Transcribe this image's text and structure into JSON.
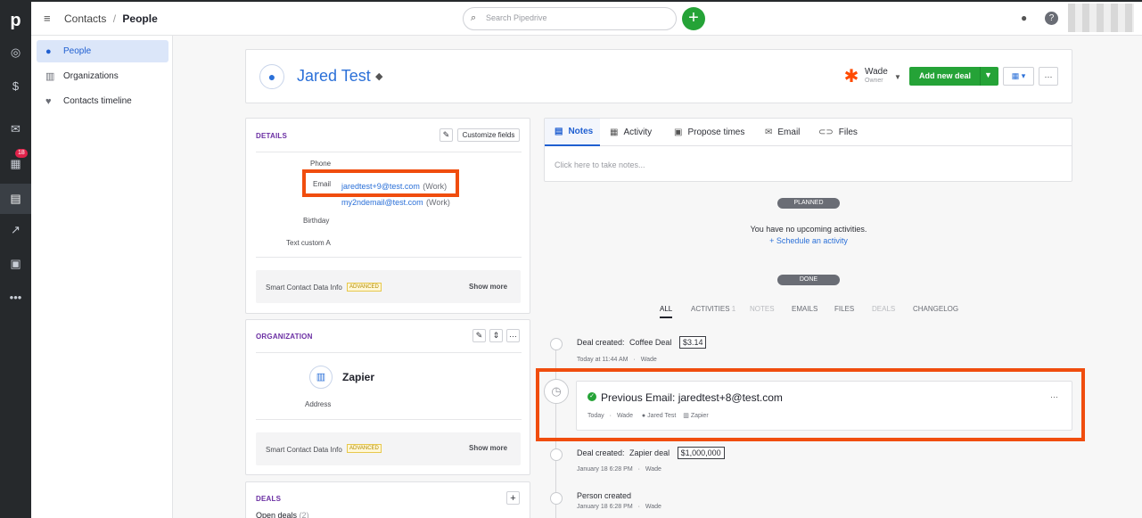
{
  "breadcrumb": {
    "section": "Contacts",
    "separator": "/",
    "page": "People"
  },
  "search": {
    "placeholder": "Search Pipedrive"
  },
  "leftbar": {
    "calendar_badge": "18"
  },
  "sidenav": {
    "items": [
      {
        "label": "People",
        "icon": "person-icon",
        "active": true
      },
      {
        "label": "Organizations",
        "icon": "building-icon",
        "active": false
      },
      {
        "label": "Contacts timeline",
        "icon": "heartbeat-icon",
        "active": false
      }
    ]
  },
  "person": {
    "name": "Jared Test",
    "owner_name": "Wade",
    "owner_label": "Owner",
    "add_deal_label": "Add new deal"
  },
  "details": {
    "title": "DETAILS",
    "customize_label": "Customize fields",
    "phone_label": "Phone",
    "email_label": "Email",
    "email1": "jaredtest+9@test.com",
    "email1_type": "(Work)",
    "email2": "my2ndemail@test.com",
    "email2_type": "(Work)",
    "birthday_label": "Birthday",
    "text_custom_label": "Text custom A",
    "smart_label": "Smart Contact Data Info",
    "advanced_badge": "ADVANCED",
    "show_more": "Show more"
  },
  "organization": {
    "title": "ORGANIZATION",
    "name": "Zapier",
    "address_label": "Address",
    "smart_label": "Smart Contact Data Info",
    "advanced_badge": "ADVANCED",
    "show_more": "Show more"
  },
  "deals": {
    "title": "DEALS",
    "open_label": "Open deals",
    "open_count": "(2)"
  },
  "tabs": [
    {
      "label": "Notes",
      "active": true
    },
    {
      "label": "Activity",
      "active": false
    },
    {
      "label": "Propose times",
      "active": false
    },
    {
      "label": "Email",
      "active": false
    },
    {
      "label": "Files",
      "active": false
    }
  ],
  "notes": {
    "placeholder": "Click here to take notes..."
  },
  "planned": {
    "pill": "PLANNED",
    "empty_text": "You have no upcoming activities.",
    "schedule_link": "+ Schedule an activity"
  },
  "done": {
    "pill": "DONE"
  },
  "filter_tabs": [
    {
      "label": "ALL",
      "state": "active"
    },
    {
      "label": "ACTIVITIES",
      "count": "1",
      "state": "normal"
    },
    {
      "label": "NOTES",
      "state": "disabled"
    },
    {
      "label": "EMAILS",
      "state": "normal"
    },
    {
      "label": "FILES",
      "state": "normal"
    },
    {
      "label": "DEALS",
      "state": "disabled"
    },
    {
      "label": "CHANGELOG",
      "state": "normal"
    }
  ],
  "timeline": {
    "ev1": {
      "prefix": "Deal created:",
      "deal": "Coffee Deal",
      "amount": "$3.14",
      "when": "Today at 11:44 AM",
      "dot": "·",
      "user": "Wade"
    },
    "email": {
      "title": "Previous Email: jaredtest+8@test.com",
      "when": "Today",
      "dot": "·",
      "user": "Wade",
      "person": "Jared Test",
      "org": "Zapier"
    },
    "ev2": {
      "prefix": "Deal created:",
      "deal": "Zapier deal",
      "amount": "$1,000,000",
      "when": "January 18 6:28 PM",
      "dot": "·",
      "user": "Wade"
    },
    "ev3": {
      "title": "Person created",
      "when": "January 18 6:28 PM",
      "dot": "·",
      "user": "Wade"
    }
  },
  "colors": {
    "accent": "#2b70d8",
    "green": "#25a337",
    "highlight": "#f04d0e",
    "sidebar": "#26292c"
  }
}
